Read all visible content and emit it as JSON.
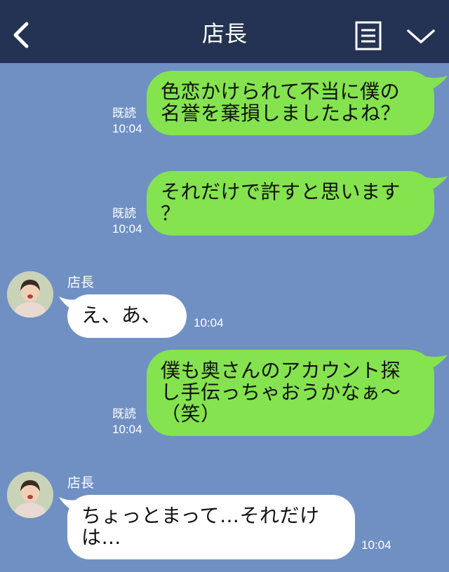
{
  "header": {
    "title": "店長",
    "back_icon": "chevron-left-icon",
    "menu_icon": "note-icon",
    "collapse_icon": "chevron-down-icon",
    "background": "#243353"
  },
  "colors": {
    "chat_background": "#7090c4",
    "sent_bubble": "#84e34f",
    "received_bubble": "#ffffff"
  },
  "messages": [
    {
      "direction": "sent",
      "text": "色恋かけられて不当に僕の\n名誉を棄損しましたよね？",
      "read": "既読",
      "time": "10:04"
    },
    {
      "direction": "sent",
      "text": "それだけで許すと思います\n？",
      "read": "既読",
      "time": "10:04"
    },
    {
      "direction": "received",
      "sender": "店長",
      "text": "え、あ、",
      "time": "10:04"
    },
    {
      "direction": "sent",
      "text": "僕も奥さんのアカウント探\nし手伝っちゃおうかなぁ～\n（笑）",
      "read": "既読",
      "time": "10:04"
    },
    {
      "direction": "received",
      "sender": "店長",
      "text": "ちょっとまって…それだけ\nは…",
      "time": "10:04"
    }
  ]
}
